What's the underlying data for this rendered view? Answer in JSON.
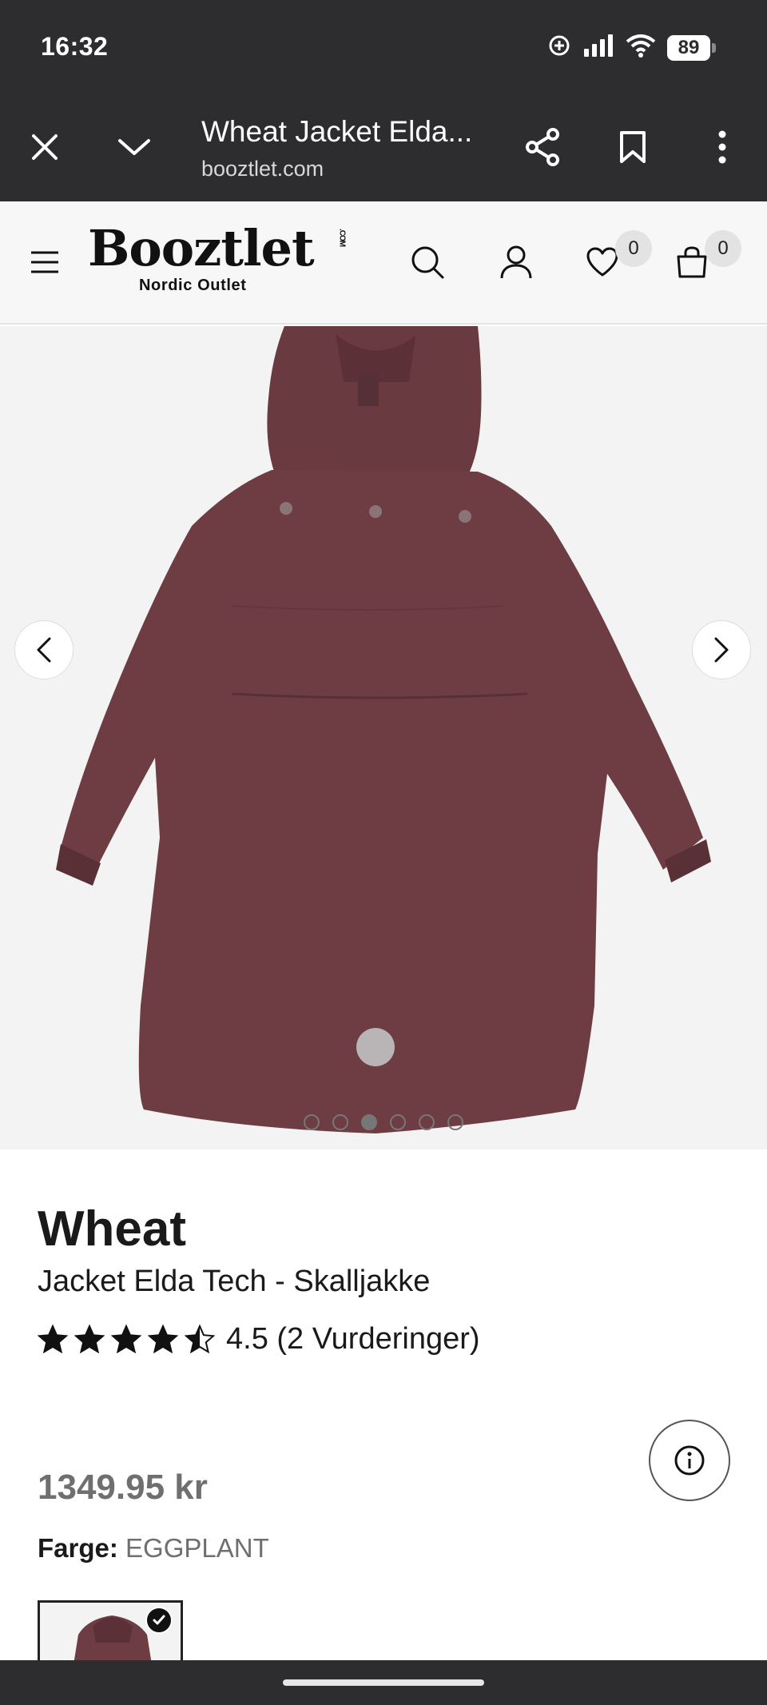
{
  "status_bar": {
    "time": "16:32",
    "battery": "89",
    "icons": [
      "location-sync-icon",
      "signal-icon",
      "wifi-icon",
      "battery-icon"
    ]
  },
  "browser": {
    "title": "Wheat Jacket Elda...",
    "domain": "booztlet.com",
    "buttons": [
      "close-icon",
      "chevron-down-icon",
      "share-icon",
      "bookmark-icon",
      "more-icon"
    ]
  },
  "site_header": {
    "logo_text": "Booztlet",
    "logo_com": ".COM",
    "logo_sub": "Nordic Outlet",
    "wishlist_count": "0",
    "cart_count": "0"
  },
  "gallery": {
    "image_alt": "Jacket back view",
    "image_count": 6,
    "active_index": 2,
    "jacket_color": "#6e3d44"
  },
  "product": {
    "brand": "Wheat",
    "name": "Jacket Elda Tech - Skalljakke",
    "rating_value": 4.5,
    "rating_text": "4.5 (2 Vurderinger)",
    "price": "1349.95 kr",
    "color_label": "Farge:",
    "color_value": "EGGPLANT"
  },
  "colors": {
    "chrome_bg": "#2d2d30",
    "header_bg": "#f7f7f7",
    "price_grey": "#6f6f6f"
  }
}
